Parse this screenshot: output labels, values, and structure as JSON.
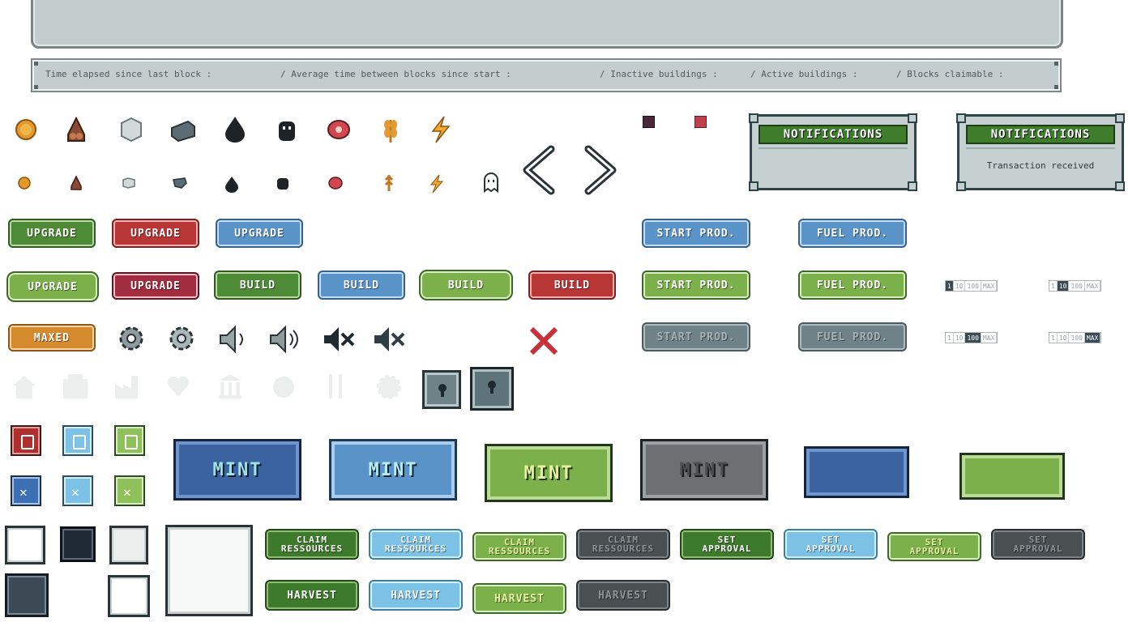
{
  "status_bar": {
    "elapsed": "Time elapsed since last block :",
    "average": "/ Average time between blocks since start :",
    "inactive": "/ Inactive buildings :",
    "active": "/ Active buildings :",
    "claimable": "/ Blocks claimable :"
  },
  "icons_large": [
    "coin-icon",
    "wood-icon",
    "stone-icon",
    "iron-icon",
    "oil-icon",
    "worker-icon",
    "meat-icon",
    "wheat-icon",
    "energy-icon"
  ],
  "icons_small": [
    "coin-icon",
    "wood-icon",
    "stone-icon",
    "iron-icon",
    "oil-icon",
    "worker-icon",
    "meat-icon",
    "wheat-icon",
    "energy-icon",
    "ghost-icon"
  ],
  "notifications": [
    {
      "title": "NOTIFICATIONS",
      "message": ""
    },
    {
      "title": "NOTIFICATIONS",
      "message": "Transaction received"
    }
  ],
  "buttons": {
    "upgrade": "UPGRADE",
    "build": "BUILD",
    "maxed": "MAXED",
    "start_prod": "START PROD.",
    "fuel_prod": "FUEL PROD.",
    "mint": "MINT",
    "claim_line1": "CLAIM",
    "claim_line2": "RESSOURCES",
    "set_line1": "SET",
    "set_line2": "APPROVAL",
    "harvest": "HARVEST"
  },
  "level_options": [
    "1",
    "10",
    "100",
    "MAX"
  ],
  "colors": {
    "green": "#4f8a37",
    "red": "#b83636",
    "blue": "#5a93c7",
    "light_green": "#7bb04a",
    "orange": "#d68a2e",
    "panel": "#c4cdcd"
  }
}
